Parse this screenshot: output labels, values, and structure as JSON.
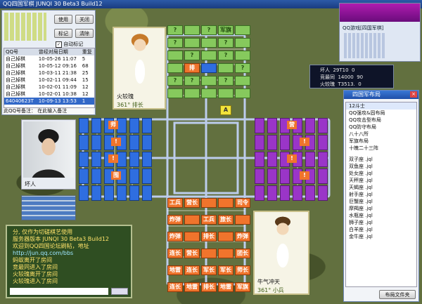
{
  "title_bar": "QQ四国军棋 JUNQI 30 Beta3 Build12",
  "top_left_panel": {
    "buttons": [
      "使用",
      "关闭"
    ],
    "mark_buttons": [
      "标记",
      "清除"
    ],
    "auto_mark_label": "自动标记",
    "table_headers": [
      "QQ号",
      "曾经对局日期",
      "重复"
    ],
    "rows": [
      [
        "自己掉棋",
        "10-05-26 11:07",
        "5"
      ],
      [
        "自己掉棋",
        "10-05-12 09:16",
        "68"
      ],
      [
        "自己掉棋",
        "10-03-11 21:38",
        "25"
      ],
      [
        "自己掉棋",
        "10-02-11 09:44",
        "15"
      ],
      [
        "自己掉棋",
        "10-02-01 11:09",
        "12"
      ],
      [
        "自己掉棋",
        "10-02-01 10:38",
        "12"
      ],
      [
        "64040623T",
        "10-09-13 13:53",
        "1"
      ]
    ],
    "note_placeholder": "此QQ号备注：    在此输入备注"
  },
  "player_top": {
    "name": "火较瑰",
    "rank": "361° 排长"
  },
  "player_bottom": {
    "name": "牛气冲天",
    "rank": "361° 小兵"
  },
  "player_left": {
    "name": "坏人"
  },
  "right_top": {
    "info": "QQ游戏[四国军棋]",
    "players": [
      {
        "name": "坏人",
        "a": "29T10",
        "b": "0"
      },
      {
        "name": "竞最同",
        "a": "14000",
        "b": "90"
      },
      {
        "name": "火较瑰",
        "a": "T3513.",
        "b": "0"
      }
    ]
  },
  "layout_popup": {
    "title": "四国军布局",
    "items": [
      "12斗士",
      "QQ强攻&固布局",
      "QQ攻击型布局",
      "QQ防守布局",
      "八十八所",
      "军旗布局",
      "十魄二十三阵",
      "双子座 .jql",
      "双鱼座 .jql",
      "处女座 .jql",
      "天秤座 .jql",
      "天蝎座 .jql",
      "射手座 .jql",
      "巨蟹座 .jql",
      "摩羯座 .jql",
      "水瓶座 .jql",
      "狮子座 .jql",
      "白羊座 .jql",
      "金牛座 .jql"
    ],
    "file_button": "布局文件夹"
  },
  "chat_lines": [
    "分, 仅作为切磋棋艺使用",
    "服务器版本 JUNQI 30 Beta3 Build12",
    "欢迎到QQ四国论坛刷帖，地址",
    "http://jun.qq.com/bbs",
    "蚂蚁离开了房间",
    "竞最同进入了房间",
    "火较瑰离开了房间",
    "火较瑰进入了房间"
  ],
  "board": {
    "top_side": [
      [
        "gl:?",
        "gl:",
        "gl:?",
        "gl:军旗",
        "gl:"
      ],
      [
        "gl:?",
        "gl:",
        "gl:",
        "gl:?",
        "gl:"
      ],
      [
        "gl:",
        "gl:?",
        "gl:",
        "gl:?",
        "gl:"
      ],
      [
        "gl:",
        "o:排",
        "b:",
        "gl:",
        "gl:?"
      ],
      [
        "gl:?",
        "gl:?",
        "gl:",
        "gl:?",
        "gl:"
      ],
      [
        "gl:",
        "gl:",
        "gl:",
        "gl:",
        "gl:"
      ]
    ],
    "bottom_side": [
      [
        "o:工兵",
        "o:营长",
        "o:",
        "o:",
        "o:司令"
      ],
      [
        "o:炸弹",
        "o:",
        "o:工兵",
        "o:旅长",
        "o:"
      ],
      [
        "o:炸弹",
        "o:",
        "o:排长",
        "o:",
        "o:炸弹"
      ],
      [
        "o:连长",
        "o:营长",
        "o:",
        "o:",
        "o:团长"
      ],
      [
        "o:地雷",
        "o:连长",
        "o:军长",
        "o:军长",
        "o:师长"
      ],
      [
        "o:连长",
        "o:地雷",
        "o:排长",
        "o:地雷",
        "o:军旗"
      ]
    ],
    "left_marks": [
      "师",
      "!",
      "!",
      "围"
    ],
    "right_marks": [
      "营",
      "!",
      "!",
      "!"
    ],
    "center_mark": "A"
  },
  "colors": {
    "top": "#86c95d",
    "bottom": "#f0742c",
    "left": "#2f6ee0",
    "right": "#9a35c8"
  }
}
